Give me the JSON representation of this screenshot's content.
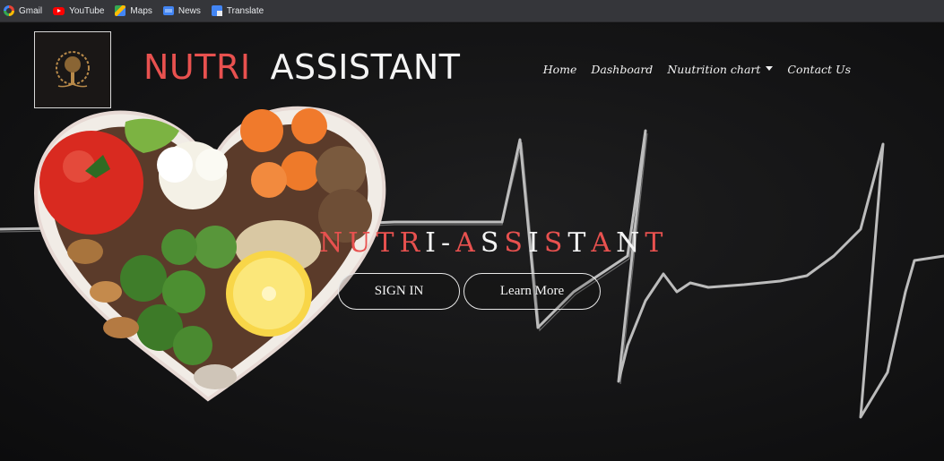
{
  "bookmarks": [
    {
      "label": "Gmail",
      "icon": "gmail-icon"
    },
    {
      "label": "YouTube",
      "icon": "youtube-icon"
    },
    {
      "label": "Maps",
      "icon": "maps-icon"
    },
    {
      "label": "News",
      "icon": "news-icon"
    },
    {
      "label": "Translate",
      "icon": "translate-icon"
    }
  ],
  "brand": {
    "part1": "NUTRI",
    "part2": "ASSISTANT",
    "color_part1": "#e8514f",
    "color_part2": "#f4f4f4"
  },
  "nav": {
    "home": "Home",
    "dashboard": "Dashboard",
    "nutrition_chart": "Nuutrition chart",
    "contact": "Contact Us"
  },
  "hero": {
    "title": "NUTRI-ASSISTANT",
    "letter_colors": [
      "#e8514f",
      "#e8514f",
      "#e8514f",
      "#e8514f",
      "#f4f4f4",
      "#f4f4f4",
      "#e8514f",
      "#f4f4f4",
      "#e8514f",
      "#f4f4f4",
      "#e8514f",
      "#f4f4f4",
      "#e8514f",
      "#f4f4f4",
      "#e8514f"
    ],
    "sign_in": "SIGN IN",
    "learn_more": "Learn More"
  }
}
